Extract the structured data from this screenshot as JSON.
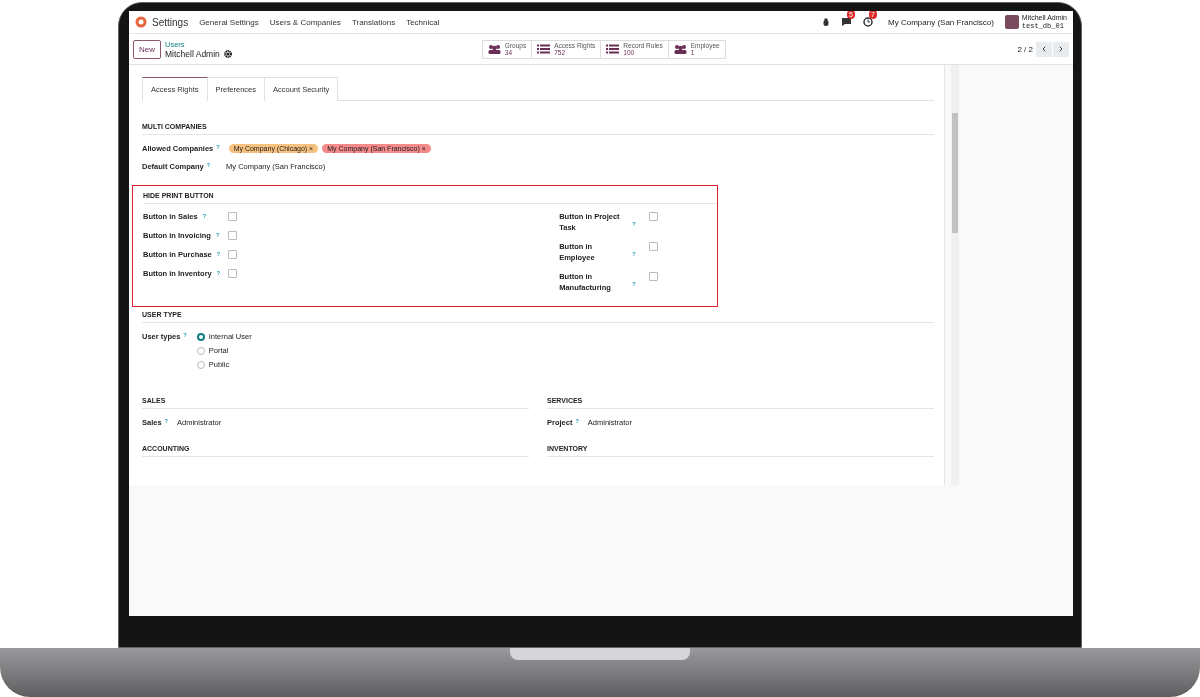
{
  "navbar": {
    "app": "Settings",
    "menu": [
      "General Settings",
      "Users & Companies",
      "Translations",
      "Technical"
    ],
    "messages_badge": "5",
    "activities_badge": "7",
    "company": "My Company (San Francisco)",
    "user": "Mitchell Admin",
    "database": "test_db_01"
  },
  "control_panel": {
    "new_button": "New",
    "breadcrumb": "Users",
    "record": "Mitchell Admin",
    "pager": "2 / 2",
    "smart_buttons": [
      {
        "kind": "users",
        "label": "Groups",
        "value": "34"
      },
      {
        "kind": "list",
        "label": "Access Rights",
        "value": "752"
      },
      {
        "kind": "list",
        "label": "Record Rules",
        "value": "100"
      },
      {
        "kind": "users",
        "label": "Employee",
        "value": "1"
      }
    ]
  },
  "tabs": [
    {
      "label": "Access Rights",
      "selected": true
    },
    {
      "label": "Preferences",
      "selected": false
    },
    {
      "label": "Account Security",
      "selected": false
    }
  ],
  "multi_companies": {
    "title": "MULTI COMPANIES",
    "allowed_label": "Allowed Companies",
    "allowed_help": "?",
    "tags": [
      {
        "label": "My Company (Chicago)",
        "remove": "×",
        "color": "#f7c27f"
      },
      {
        "label": "My Company (San Francisco)",
        "remove": "×",
        "color": "#f48a8a"
      }
    ],
    "default_label": "Default Company",
    "default_help": "?",
    "default_value": "My Company (San Francisco)"
  },
  "hide_print": {
    "title": "HIDE PRINT BUTTON",
    "highlighted": true,
    "left": [
      {
        "label": "Button in Sales",
        "help": "?",
        "checked": false
      },
      {
        "label": "Button in Invoicing",
        "help": "?",
        "checked": false
      },
      {
        "label": "Button in Purchase",
        "help": "?",
        "checked": false
      },
      {
        "label": "Button in Inventory",
        "help": "?",
        "checked": false
      }
    ],
    "right": [
      {
        "label": "Button in Project Task",
        "help": "?",
        "checked": false
      },
      {
        "label": "Button in Employee",
        "help": "?",
        "checked": false
      },
      {
        "label": "Button in Manufacturing",
        "help": "?",
        "checked": false
      }
    ]
  },
  "user_type": {
    "title": "USER TYPE",
    "label": "User types",
    "help": "?",
    "options": [
      {
        "label": "Internal User",
        "selected": true
      },
      {
        "label": "Portal",
        "selected": false
      },
      {
        "label": "Public",
        "selected": false
      }
    ]
  },
  "groups": [
    {
      "title": "SALES",
      "field": "Sales",
      "help": "?",
      "value": "Administrator"
    },
    {
      "title": "SERVICES",
      "field": "Project",
      "help": "?",
      "value": "Administrator"
    },
    {
      "title": "ACCOUNTING"
    },
    {
      "title": "INVENTORY"
    }
  ]
}
